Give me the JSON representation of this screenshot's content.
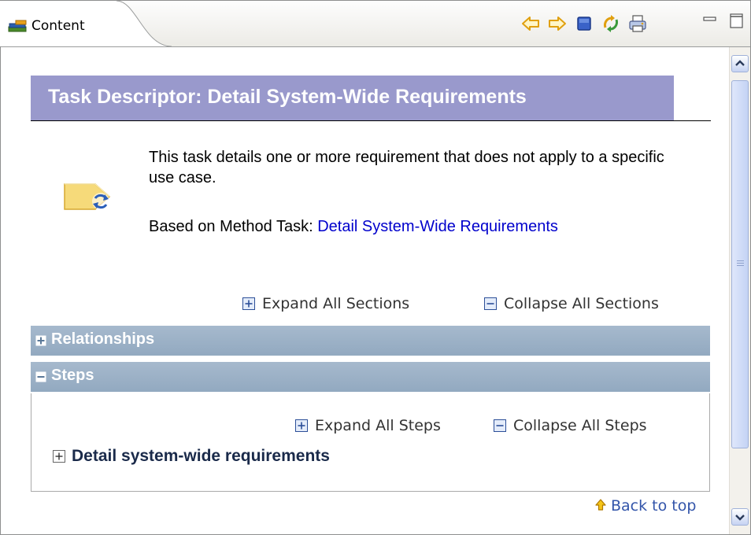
{
  "tab": {
    "label": "Content"
  },
  "toolbar": {
    "icons": [
      "back-arrow-icon",
      "forward-arrow-icon",
      "stop-icon",
      "sync-icon",
      "print-icon",
      "minimize-icon",
      "maximize-icon"
    ]
  },
  "page": {
    "title": "Task Descriptor: Detail System-Wide Requirements",
    "description": "This task details one or more requirement that does not apply to a specific use case.",
    "based_on_prefix": "Based on Method Task: ",
    "based_on_link": "Detail System-Wide Requirements",
    "expand_all_sections": "Expand All Sections",
    "collapse_all_sections": "Collapse All Sections"
  },
  "sections": {
    "relationships": {
      "label": "Relationships",
      "state": "collapsed"
    },
    "steps": {
      "label": "Steps",
      "state": "expanded",
      "expand_all": "Expand All Steps",
      "collapse_all": "Collapse All Steps",
      "items": [
        {
          "label": "Detail system-wide requirements"
        }
      ]
    }
  },
  "footer": {
    "back_to_top": "Back to top"
  },
  "colors": {
    "title_bg": "#9999cc",
    "section_bg": "#9fb3c8",
    "link": "#0000cc"
  }
}
